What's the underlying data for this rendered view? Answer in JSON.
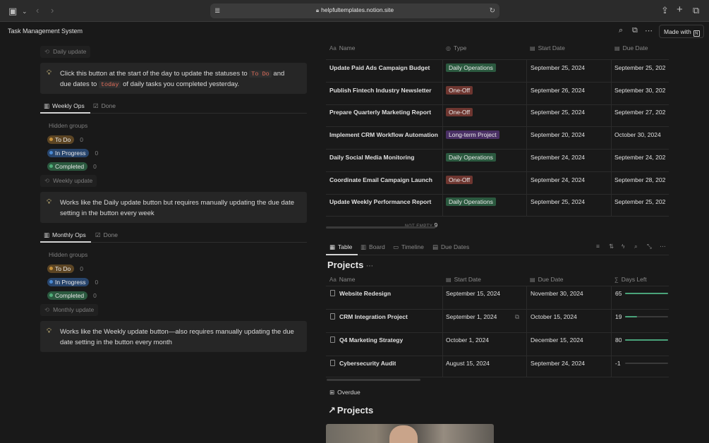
{
  "browser": {
    "url": "helpfultemplates.notion.site"
  },
  "topbar": {
    "title": "Task Management System",
    "made_with": "Made with"
  },
  "left": {
    "daily_update": "Daily update",
    "callout1_pre": "Click this button at the start of the day to update the statuses to ",
    "callout1_code1": "To Do",
    "callout1_mid": " and due dates to ",
    "callout1_code2": "today",
    "callout1_post": " of daily tasks you completed yesterday.",
    "weekly_tabs": [
      "Weekly Ops",
      "Done"
    ],
    "hidden_groups": "Hidden groups",
    "groups": [
      {
        "label": "To Do",
        "count": "0"
      },
      {
        "label": "In Progress",
        "count": "0"
      },
      {
        "label": "Completed",
        "count": "0"
      }
    ],
    "weekly_update": "Weekly update",
    "callout2": "Works like the Daily update button but requires manually updating the due date setting in the button every week",
    "monthly_tabs": [
      "Monthly Ops",
      "Done"
    ],
    "groups2": [
      {
        "label": "To Do",
        "count": "0"
      },
      {
        "label": "In Progress",
        "count": "0"
      },
      {
        "label": "Completed",
        "count": "0"
      }
    ],
    "monthly_update": "Monthly update",
    "callout3": "Works like the Weekly update button—also requires manually updating the due date setting in the button every month"
  },
  "tasks": {
    "headers": {
      "name": "Name",
      "type": "Type",
      "start": "Start Date",
      "due": "Due Date"
    },
    "rows": [
      {
        "name": "Update Paid Ads Campaign Budget",
        "type": "Daily Operations",
        "start": "September 25, 2024",
        "due": "September 25, 202"
      },
      {
        "name": "Publish Fintech Industry Newsletter",
        "type": "One-Off",
        "start": "September 26, 2024",
        "due": "September 30, 202"
      },
      {
        "name": "Prepare Quarterly Marketing Report",
        "type": "One-Off",
        "start": "September 25, 2024",
        "due": "September 27, 202"
      },
      {
        "name": "Implement CRM Workflow Automation",
        "type": "Long-term Project",
        "start": "September 20, 2024",
        "due": "October 30, 2024"
      },
      {
        "name": "Daily Social Media Monitoring",
        "type": "Daily Operations",
        "start": "September 24, 2024",
        "due": "September 24, 202"
      },
      {
        "name": "Coordinate Email Campaign Launch",
        "type": "One-Off",
        "start": "September 24, 2024",
        "due": "September 28, 202"
      },
      {
        "name": "Update Weekly Performance Report",
        "type": "Daily Operations",
        "start": "September 25, 2024",
        "due": "September 25, 202"
      }
    ],
    "footer_label": "NOT EMPTY",
    "footer_count": "9",
    "type_colors": {
      "Daily Operations": "#2b593f",
      "One-Off": "#6e3630",
      "Long-term Project": "#492f64"
    }
  },
  "views": {
    "tabs": [
      "Table",
      "Board",
      "Timeline",
      "Due Dates"
    ]
  },
  "projects": {
    "title": "Projects",
    "headers": {
      "name": "Name",
      "start": "Start Date",
      "due": "Due Date",
      "days": "Days Left"
    },
    "rows": [
      {
        "name": "Website Redesign",
        "start": "September 15, 2024",
        "due": "November 30, 2024",
        "days": "65",
        "progress": 1.0
      },
      {
        "name": "CRM Integration Project",
        "start": "September 1, 2024",
        "due": "October 15, 2024",
        "days": "19",
        "progress": 0.28
      },
      {
        "name": "Q4 Marketing Strategy",
        "start": "October 1, 2024",
        "due": "December 15, 2024",
        "days": "80",
        "progress": 1.0
      },
      {
        "name": "Cybersecurity Audit",
        "start": "August 15, 2024",
        "due": "September 24, 2024",
        "days": "-1",
        "progress": 0
      }
    ]
  },
  "overdue": "Overdue",
  "projects_link": "Projects"
}
